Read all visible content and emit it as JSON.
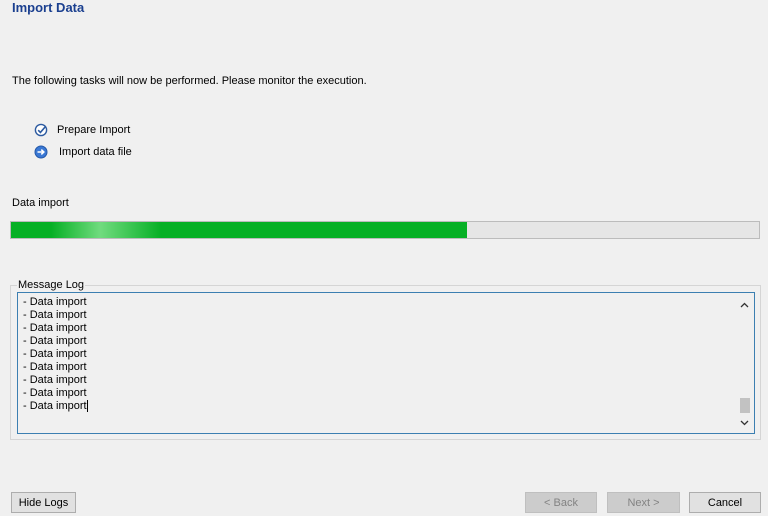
{
  "header": {
    "title": "Import Data"
  },
  "intro_text": "The following tasks will now be performed. Please monitor the execution.",
  "tasks": [
    {
      "label": "Prepare Import",
      "status": "done",
      "icon": "check-circle-icon"
    },
    {
      "label": "Import data file",
      "status": "in-progress",
      "icon": "arrow-right-circle-icon"
    }
  ],
  "progress": {
    "label": "Data import",
    "percent": 61,
    "fill_color": "#06b025"
  },
  "log": {
    "legend": "Message Log",
    "lines": [
      "- Data import",
      "- Data import",
      "- Data import",
      "- Data import",
      "- Data import",
      "- Data import",
      "- Data import",
      "- Data import",
      "- Data import"
    ]
  },
  "buttons": {
    "hide_logs": "Hide Logs",
    "back": "< Back",
    "next": "Next >",
    "cancel": "Cancel"
  },
  "colors": {
    "accent": "#1a3f8f",
    "log_border": "#3c7fb1"
  }
}
